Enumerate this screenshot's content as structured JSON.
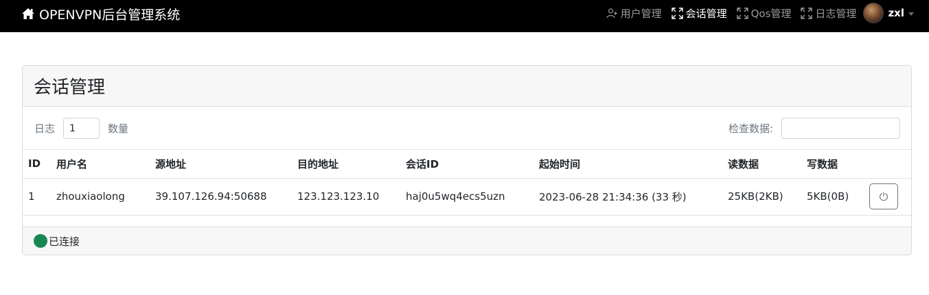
{
  "navbar": {
    "brand_title": "OPENVPN后台管理系统",
    "brand_icon": "home-icon",
    "items": [
      {
        "label": "用户管理",
        "icon": "user-plus-icon",
        "active": false
      },
      {
        "label": "会话管理",
        "icon": "fullscreen-icon",
        "active": true
      },
      {
        "label": "Qos管理",
        "icon": "fullscreen-icon",
        "active": false
      },
      {
        "label": "日志管理",
        "icon": "fullscreen-icon",
        "active": false
      }
    ],
    "user": {
      "name": "zxl",
      "avatar": "avatar"
    }
  },
  "colors": {
    "navbar_bg": "#000000",
    "nav_inactive": "#9a9a9a",
    "status_connected": "#198754"
  },
  "card": {
    "title": "会话管理",
    "toolbar": {
      "log_label": "日志",
      "log_value": "1",
      "count_label": "数量",
      "search_label": "检查数据:",
      "search_value": ""
    },
    "table": {
      "columns": [
        "ID",
        "用户名",
        "源地址",
        "目的地址",
        "会话ID",
        "起始时间",
        "读数据",
        "写数据",
        ""
      ],
      "rows": [
        {
          "id": "1",
          "username": "zhouxiaolong",
          "source": "39.107.126.94:50688",
          "destination": "123.123.123.10",
          "session_id": "haj0u5wq4ecs5uzn",
          "start_time": "2023-06-28 21:34:36 (33 秒)",
          "read": "25KB(2KB)",
          "write": "5KB(0B)",
          "action_icon": "power-icon"
        }
      ]
    },
    "footer": {
      "status_text": "已连接"
    }
  }
}
